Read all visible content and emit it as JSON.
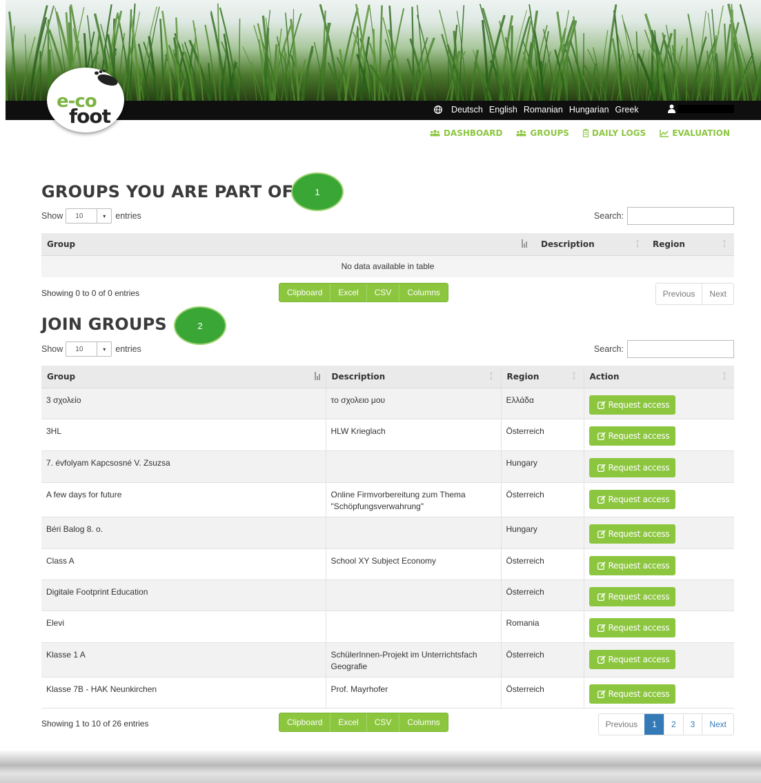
{
  "logo": {
    "line1": "e-co",
    "line2": "foot"
  },
  "languages": [
    "Deutsch",
    "English",
    "Romanian",
    "Hungarian",
    "Greek"
  ],
  "nav": [
    {
      "label": "DASHBOARD",
      "icon": "users-icon"
    },
    {
      "label": "GROUPS",
      "icon": "users-icon"
    },
    {
      "label": "DAILY LOGS",
      "icon": "clipboard-icon"
    },
    {
      "label": "EVALUATION",
      "icon": "chart-icon"
    }
  ],
  "section1": {
    "title": "GROUPS YOU ARE PART OF",
    "badge": "1",
    "show": "Show",
    "entries_value": "10",
    "entries": "entries",
    "search_label": "Search:",
    "columns": [
      "Group",
      "Description",
      "Region"
    ],
    "empty": "No data available in table",
    "info": "Showing 0 to 0 of 0 entries",
    "buttons": [
      "Clipboard",
      "Excel",
      "CSV",
      "Columns"
    ],
    "pager": {
      "prev": "Previous",
      "next": "Next"
    }
  },
  "section2": {
    "title": "JOIN GROUPS",
    "badge": "2",
    "show": "Show",
    "entries_value": "10",
    "entries": "entries",
    "search_label": "Search:",
    "columns": [
      "Group",
      "Description",
      "Region",
      "Action"
    ],
    "action_label": "Request access",
    "rows": [
      {
        "group": "3 σχολείο",
        "description": "το σχολειο μου",
        "region": "Ελλάδα"
      },
      {
        "group": "3HL",
        "description": "HLW Krieglach",
        "region": "Österreich"
      },
      {
        "group": "7. évfolyam Kapcsosné V. Zsuzsa",
        "description": "",
        "region": "Hungary"
      },
      {
        "group": "A few days for future",
        "description": "Online Firmvorbereitung zum Thema \"Schöpfungsverwahrung\"",
        "region": "Österreich"
      },
      {
        "group": "Béri Balog 8. o.",
        "description": "",
        "region": "Hungary"
      },
      {
        "group": "Class A",
        "description": "School XY Subject Economy",
        "region": "Österreich"
      },
      {
        "group": "Digitale Footprint Education",
        "description": "",
        "region": "Österreich"
      },
      {
        "group": "Elevi",
        "description": "",
        "region": "Romania"
      },
      {
        "group": "Klasse 1 A",
        "description": "SchülerInnen-Projekt im Unterrichtsfach Geografie",
        "region": "Österreich"
      },
      {
        "group": "Klasse 7B - HAK Neunkirchen",
        "description": "Prof. Mayrhofer",
        "region": "Österreich"
      }
    ],
    "info": "Showing 1 to 10 of 26 entries",
    "buttons": [
      "Clipboard",
      "Excel",
      "CSV",
      "Columns"
    ],
    "pager": {
      "prev": "Previous",
      "pages": [
        "1",
        "2",
        "3"
      ],
      "next": "Next"
    }
  }
}
